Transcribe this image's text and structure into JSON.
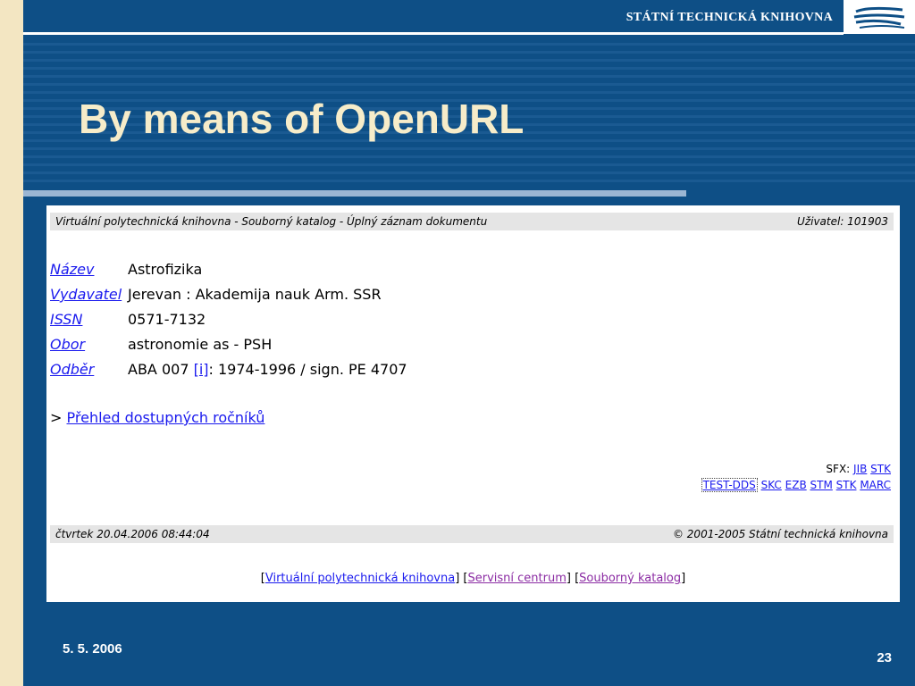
{
  "slide": {
    "org_name": "STÁTNÍ TECHNICKÁ KNIHOVNA",
    "title": "By means of OpenURL",
    "date": "5. 5. 2006",
    "page_number": "23",
    "colors": {
      "background": "#0e4f86",
      "title": "#f6ecc9",
      "left_stripe": "#f3e6c2"
    },
    "logo_icon": "stk-logo-icon"
  },
  "catalog": {
    "header_left": "Virtuální polytechnická knihovna - Souborný katalog - Úplný záznam dokumentu",
    "header_right": "Uživatel: 101903",
    "fields": [
      {
        "label": "Název",
        "value": "Astrofizika"
      },
      {
        "label": "Vydavatel",
        "value": "Jerevan : Akademija nauk Arm. SSR"
      },
      {
        "label": "ISSN",
        "value": "0571-7132"
      },
      {
        "label": "Obor",
        "value": "astronomie as - PSH"
      }
    ],
    "holdings": {
      "label": "Odběr",
      "prefix": "ABA 007 ",
      "link": "[i]",
      "suffix": ": 1974-1996 / sign. PE 4707"
    },
    "more": {
      "prefix": "> ",
      "link": "Přehled dostupných ročníků"
    },
    "sfx": {
      "prefix": "SFX: ",
      "links": [
        "JIB",
        "STK"
      ]
    },
    "services": [
      "TEST-DDS",
      "SKC",
      "EZB",
      "STM",
      "STK",
      "MARC"
    ],
    "footer_left": "čtvrtek 20.04.2006 08:44:04",
    "footer_right": "© 2001-2005 Státní technická knihovna",
    "bottom_links": [
      "Virtuální polytechnická knihovna",
      "Servisní centrum",
      "Souborný katalog"
    ]
  }
}
